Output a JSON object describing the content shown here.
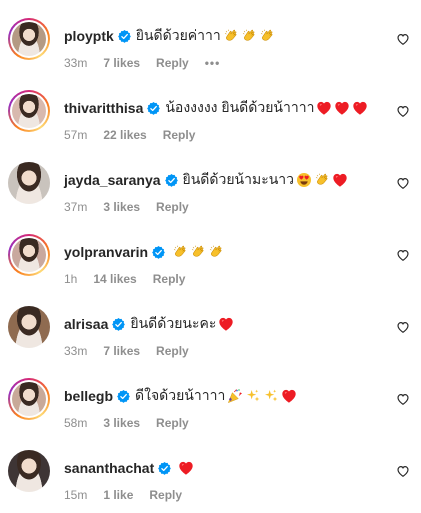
{
  "comments": [
    {
      "username": "ployptk",
      "text": "ยินดีด้วยค่าาา",
      "time": "33m",
      "likes": "7 likes",
      "reply": "Reply",
      "more": "•••",
      "emojis": [
        "clap-emoji",
        "clap-emoji",
        "clap-emoji"
      ],
      "avatar_color": "#b49a84",
      "ring": true
    },
    {
      "username": "thivaritthisa",
      "text": "น้องงงงง ยินดีด้วยน้าาาา",
      "time": "57m",
      "likes": "22 likes",
      "reply": "Reply",
      "emojis": [
        "red-heart-emoji",
        "red-heart-emoji",
        "red-heart-emoji"
      ],
      "avatar_color": "#d8b9ae",
      "ring": true
    },
    {
      "username": "jayda_saranya",
      "text": "ยินดีด้วยน้ามะนาว",
      "time": "37m",
      "likes": "3 likes",
      "reply": "Reply",
      "emojis": [
        "heart-eyes-emoji",
        "clap-emoji",
        "red-heart-emoji"
      ],
      "avatar_color": "#c9c3bd",
      "ring": false
    },
    {
      "username": "yolpranvarin",
      "text": "",
      "time": "1h",
      "likes": "14 likes",
      "reply": "Reply",
      "emojis": [
        "clap-emoji",
        "clap-emoji",
        "clap-emoji"
      ],
      "avatar_color": "#c9a89e",
      "ring": true
    },
    {
      "username": "alrisaa",
      "text": "ยินดีด้วยนะคะ",
      "time": "33m",
      "likes": "7 likes",
      "reply": "Reply",
      "emojis": [
        "red-heart-emoji"
      ],
      "avatar_color": "#8f6b50",
      "ring": false
    },
    {
      "username": "bellegb",
      "text": "ดีใจด้วยน้าาาา",
      "time": "58m",
      "likes": "3 likes",
      "reply": "Reply",
      "emojis": [
        "party-popper-emoji",
        "sparkles-emoji",
        "sparkles-emoji",
        "red-heart-emoji"
      ],
      "avatar_color": "#c8a999",
      "ring": true
    },
    {
      "username": "sananthachat",
      "text": "",
      "time": "15m",
      "likes": "1 like",
      "reply": "Reply",
      "emojis": [
        "red-heart-emoji"
      ],
      "avatar_color": "#3e3535",
      "ring": false
    }
  ],
  "colors": {
    "text": "#262626",
    "meta": "#8e8e8e",
    "verified": "#0095f6",
    "heart": "#ed1c24",
    "clap": "#f7c02b"
  }
}
